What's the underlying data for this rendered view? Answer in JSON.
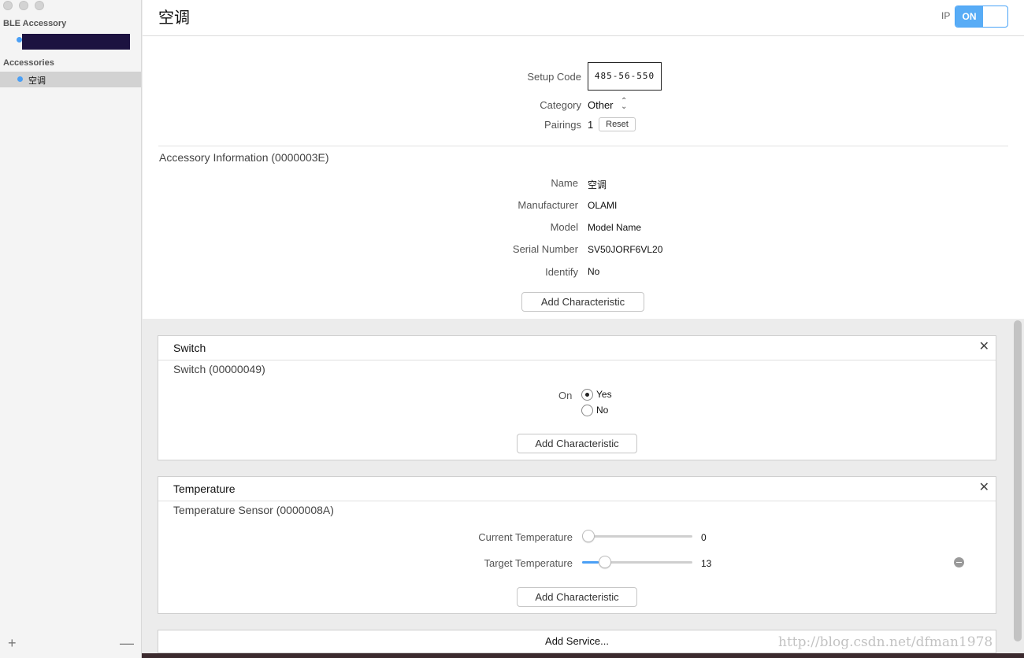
{
  "sidebar": {
    "section_ble": "BLE Accessory",
    "section_accessories": "Accessories",
    "items": [
      {
        "label": "空调"
      }
    ],
    "add_symbol": "+",
    "remove_symbol": "—"
  },
  "header": {
    "title": "空调",
    "ip_label": "IP",
    "toggle_label": "ON"
  },
  "setup": {
    "code_label": "Setup Code",
    "code_value": "485-56-550",
    "category_label": "Category",
    "category_value": "Other",
    "pairings_label": "Pairings",
    "pairings_value": "1",
    "reset_label": "Reset"
  },
  "accessory_info": {
    "title": "Accessory Information (0000003E)",
    "fields": [
      {
        "label": "Name",
        "value": "空调"
      },
      {
        "label": "Manufacturer",
        "value": "OLAMI"
      },
      {
        "label": "Model",
        "value": "Model Name"
      },
      {
        "label": "Serial Number",
        "value": "SV50JORF6VL20"
      },
      {
        "label": "Identify",
        "value": "No"
      }
    ],
    "add_characteristic": "Add Characteristic"
  },
  "services": [
    {
      "header": "Switch",
      "subtitle": "Switch (00000049)",
      "on_label": "On",
      "options": [
        "Yes",
        "No"
      ],
      "selected": "Yes",
      "add_characteristic": "Add Characteristic",
      "close_symbol": "✕"
    },
    {
      "header": "Temperature",
      "subtitle": "Temperature Sensor (0000008A)",
      "sliders": [
        {
          "label": "Current Temperature",
          "value": "0",
          "fraction": 0.0
        },
        {
          "label": "Target Temperature",
          "value": "13",
          "fraction": 0.15
        }
      ],
      "add_characteristic": "Add Characteristic",
      "close_symbol": "✕"
    }
  ],
  "add_service": "Add Service...",
  "watermark": "http://blog.csdn.net/dfman1978",
  "colors": {
    "accent": "#4a9ff5",
    "toggle": "#58acf6",
    "redacted": "#1c1240"
  }
}
